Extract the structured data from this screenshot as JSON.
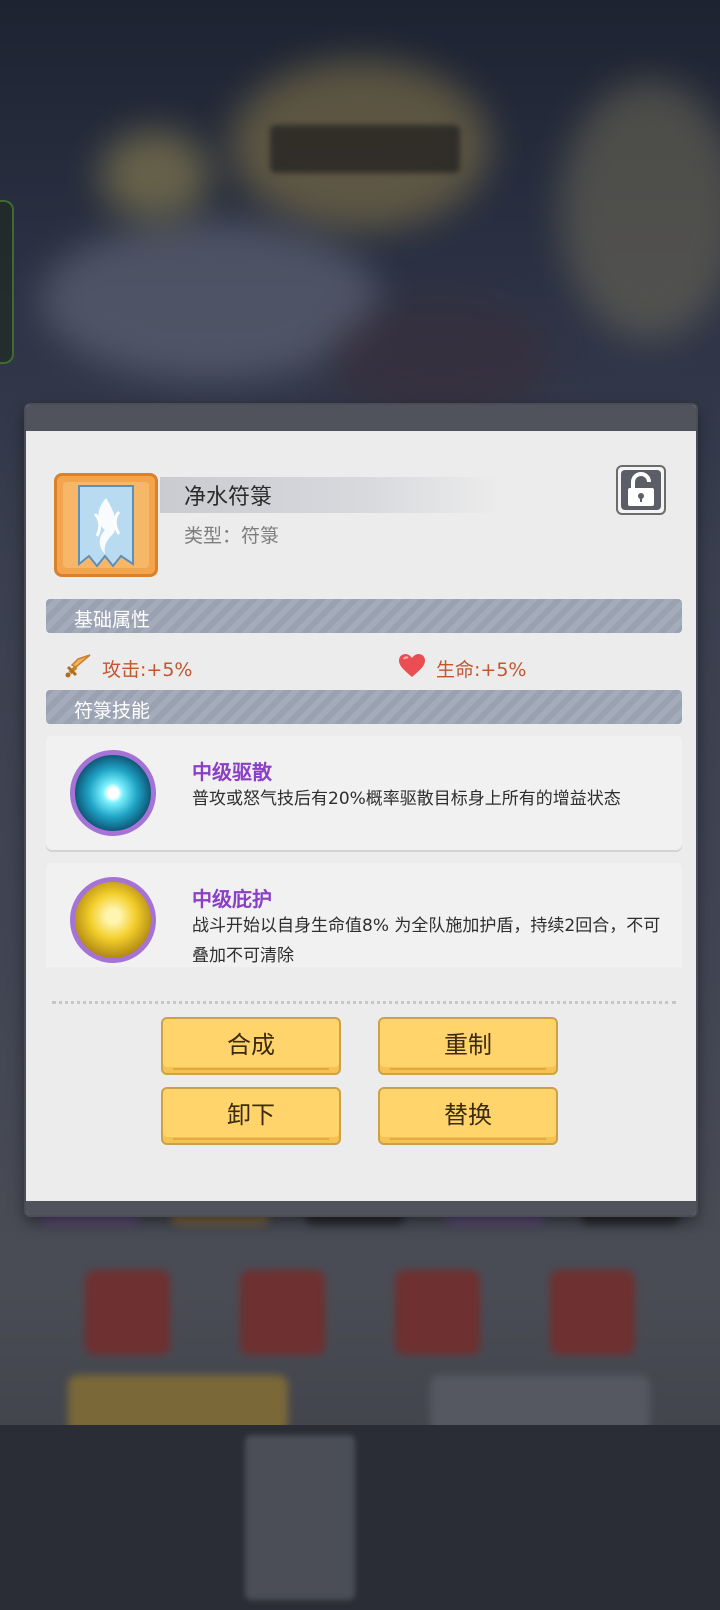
{
  "item": {
    "name": "净水符箓",
    "type_text": "类型：符箓",
    "icon": "banner-talisman-icon"
  },
  "sections": {
    "basic_attributes": "基础属性",
    "talisman_skills": "符箓技能"
  },
  "attributes": [
    {
      "icon": "sword-icon",
      "text": "攻击:+5%"
    },
    {
      "icon": "heart-icon",
      "text": "生命:+5%"
    }
  ],
  "skills": [
    {
      "name": "中级驱散",
      "desc": "普攻或怒气技后有20%概率驱散目标身上所有的增益状态",
      "icon": "dispel-orb-icon"
    },
    {
      "name": "中级庇护",
      "desc": "战斗开始以自身生命值8% 为全队施加护盾，持续2回合，不可叠加不可清除",
      "icon": "shield-figures-icon"
    }
  ],
  "buttons": {
    "compose": "合成",
    "remake": "重制",
    "unequip": "卸下",
    "replace": "替换"
  },
  "colors": {
    "accent_button": "#ffd46b",
    "skill_name": "#8a3fc6",
    "attribute_text": "#c0572e",
    "section_header": "#9aa1b1"
  }
}
